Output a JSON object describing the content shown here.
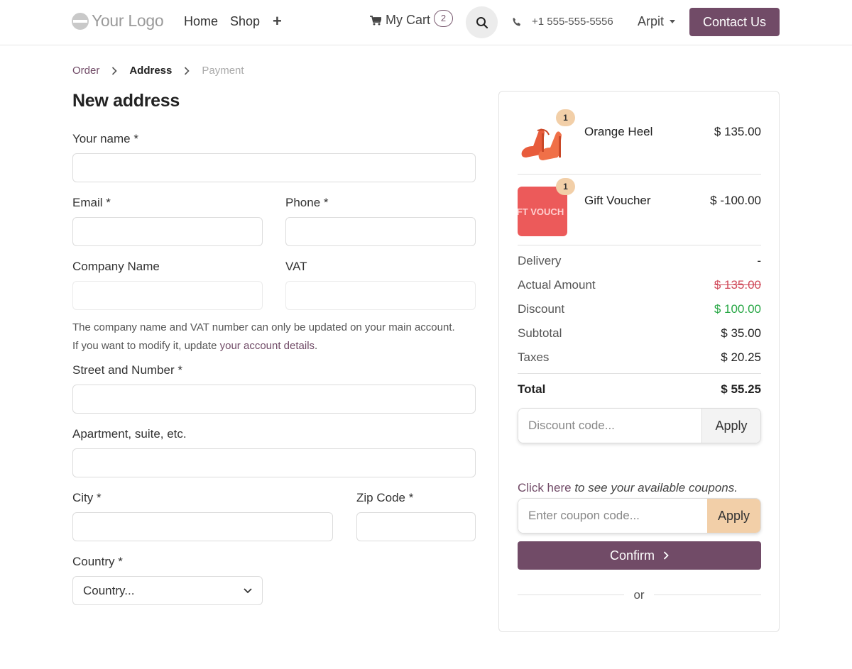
{
  "header": {
    "logo_text": "Your Logo",
    "nav": [
      {
        "label": "Home"
      },
      {
        "label": "Shop"
      }
    ],
    "plus_label": "+",
    "cart_label": "My Cart",
    "cart_count": "2",
    "phone": "+1 555-555-5556",
    "user": "Arpit",
    "contact_label": "Contact Us"
  },
  "breadcrumb": {
    "order": "Order",
    "address": "Address",
    "payment": "Payment"
  },
  "form": {
    "title": "New address",
    "name_label": "Your name *",
    "email_label": "Email *",
    "phone_label": "Phone *",
    "company_label": "Company Name",
    "vat_label": "VAT",
    "help_text": "The company name and VAT number can only be updated on your main account. If you want to modify it, update ",
    "help_link": "your account details",
    "help_end": ".",
    "street_label": "Street and Number *",
    "apartment_label": "Apartment, suite, etc.",
    "city_label": "City *",
    "zip_label": "Zip Code *",
    "country_label": "Country *",
    "country_value": "Country..."
  },
  "summary": {
    "items": [
      {
        "name": "Orange Heel",
        "price": "$ 135.00",
        "qty": "1"
      },
      {
        "name": "Gift Voucher",
        "price": "$ -100.00",
        "qty": "1",
        "thumb_text": "FT VOUCH"
      }
    ],
    "delivery_label": "Delivery",
    "delivery_value": "-",
    "actual_label": "Actual Amount",
    "actual_value": "$ 135.00",
    "discount_label": "Discount",
    "discount_value": "$ 100.00",
    "subtotal_label": "Subtotal",
    "subtotal_value": "$ 35.00",
    "taxes_label": "Taxes",
    "taxes_value": "$ 20.25",
    "total_label": "Total",
    "total_value": "$ 55.25",
    "discount_placeholder": "Discount code...",
    "apply_label": "Apply",
    "coupon_link": "Click here",
    "coupon_text": " to see your available coupons.",
    "coupon_placeholder": "Enter coupon code...",
    "coupon_apply": "Apply",
    "confirm_label": "Confirm",
    "or_label": "or"
  },
  "colors": {
    "brand": "#714b67",
    "accent": "#f2cfa8",
    "discount_green": "#28a745",
    "strike_red": "#d04a5a"
  }
}
